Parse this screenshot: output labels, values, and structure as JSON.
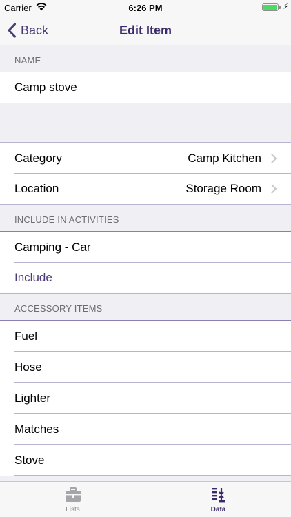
{
  "status_bar": {
    "carrier": "Carrier",
    "time": "6:26 PM"
  },
  "nav": {
    "back_label": "Back",
    "title": "Edit Item"
  },
  "name_section": {
    "header": "NAME",
    "value": "Camp stove"
  },
  "details": {
    "category_label": "Category",
    "category_value": "Camp Kitchen",
    "location_label": "Location",
    "location_value": "Storage Room"
  },
  "activities_section": {
    "header": "INCLUDE IN ACTIVITIES",
    "items": [
      "Camping - Car"
    ],
    "include_label": "Include"
  },
  "accessories_section": {
    "header": "ACCESSORY ITEMS",
    "items": [
      "Fuel",
      "Hose",
      "Lighter",
      "Matches",
      "Stove"
    ]
  },
  "tabs": [
    {
      "label": "Lists",
      "icon": "suitcase-icon",
      "active": false
    },
    {
      "label": "Data",
      "icon": "sort-icon",
      "active": true
    }
  ],
  "colors": {
    "accent": "#4a3a78",
    "title": "#3a2a6a",
    "separator": "#b9b3d0",
    "background": "#efeff4"
  }
}
